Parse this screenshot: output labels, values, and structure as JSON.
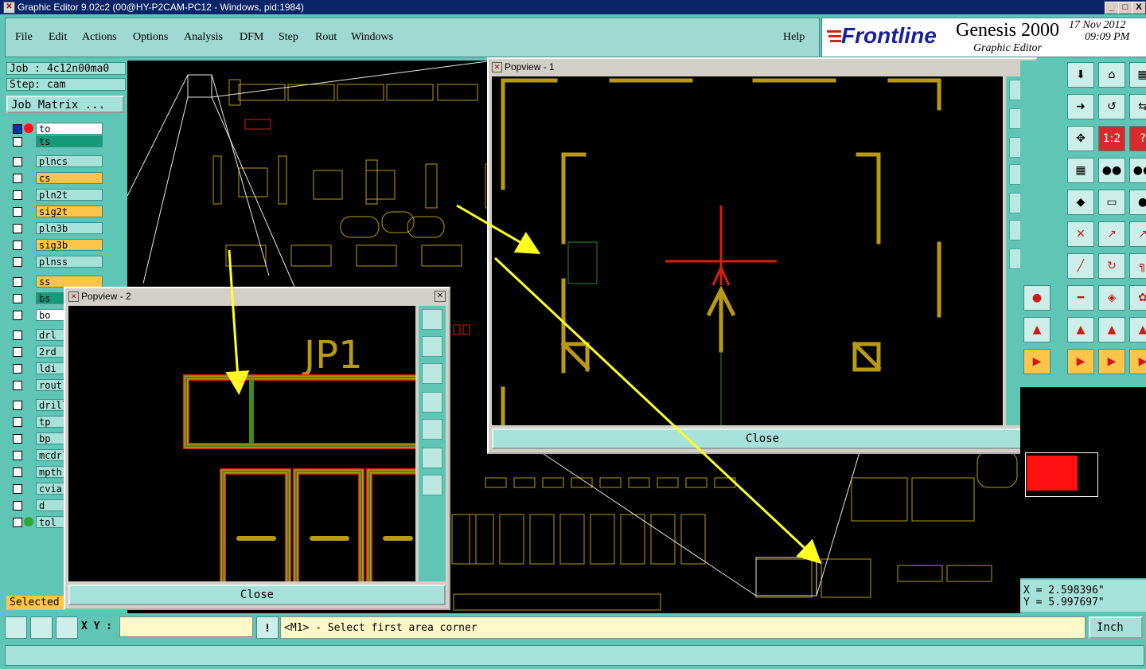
{
  "window": {
    "title": "Graphic Editor 9.02c2 (00@HY-P2CAM-PC12 - Windows, pid:1984)",
    "minimize": "_",
    "maximize": "□",
    "close": "X"
  },
  "menu": {
    "items": [
      "File",
      "Edit",
      "Actions",
      "Options",
      "Analysis",
      "DFM",
      "Step",
      "Rout",
      "Windows"
    ],
    "help": "Help"
  },
  "brand": {
    "logo": "Frontline",
    "product": "Genesis 2000",
    "subtitle": "Graphic Editor",
    "date": "17 Nov 2012",
    "time": "09:09 PM"
  },
  "job": {
    "job_label": "Job : 4c12n00ma0",
    "step_label": "Step: cam",
    "matrix_button": "Job Matrix ..."
  },
  "layers": [
    {
      "name": "to",
      "color": "#ffffff"
    },
    {
      "name": "ts",
      "color": "#169a7c"
    },
    {
      "name": "plncs",
      "color": "#a7e2da"
    },
    {
      "name": "cs",
      "color": "#ffc54a"
    },
    {
      "name": "pln2t",
      "color": "#a7e2da"
    },
    {
      "name": "sig2t",
      "color": "#ffc54a"
    },
    {
      "name": "pln3b",
      "color": "#a7e2da"
    },
    {
      "name": "sig3b",
      "color": "#ffc54a"
    },
    {
      "name": "plnss",
      "color": "#a7e2da"
    },
    {
      "name": "ss",
      "color": "#ffc54a"
    },
    {
      "name": "bs",
      "color": "#169a7c"
    },
    {
      "name": "bo",
      "color": "#ffffff"
    },
    {
      "name": "drl",
      "color": "#a7e2da"
    },
    {
      "name": "2rd",
      "color": "#a7e2da"
    },
    {
      "name": "ldi",
      "color": "#a7e2da"
    },
    {
      "name": "rout",
      "color": "#a7e2da"
    },
    {
      "name": "drill",
      "color": "#a7e2da"
    },
    {
      "name": "tp",
      "color": "#a7e2da"
    },
    {
      "name": "bp",
      "color": "#a7e2da"
    },
    {
      "name": "mcdrl",
      "color": "#a7e2da"
    },
    {
      "name": "mpth",
      "color": "#a7e2da"
    },
    {
      "name": "cvia",
      "color": "#a7e2da"
    },
    {
      "name": "d",
      "color": "#a7e2da"
    },
    {
      "name": "tol",
      "color": "#a7e2da"
    }
  ],
  "selected_label": "Selected :",
  "popview1": {
    "title": "Popview - 1",
    "close_label": "Close"
  },
  "popview2": {
    "title": "Popview - 2",
    "close_label": "Close",
    "designator": "JP1"
  },
  "coords": {
    "x": "X = 2.598396\"",
    "y": "Y = 5.997697\""
  },
  "status": {
    "xy_label": "X Y :",
    "xy_value": "",
    "message": "<M1> - Select first area corner",
    "units": "Inch"
  },
  "colors": {
    "background": "#5fc6b6",
    "pad": "#b89a14",
    "annotation": "#ffff22",
    "highlight": "#ff2a1a"
  }
}
